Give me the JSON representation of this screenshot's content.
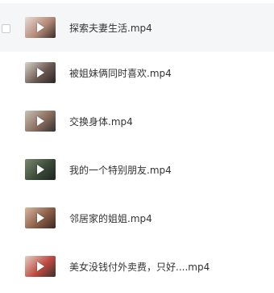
{
  "files": [
    {
      "name": "探索夫妻生活.mp4",
      "thumb_colors": [
        "#e8dcd6",
        "#b48a78",
        "#3a2c2a"
      ]
    },
    {
      "name": "被姐妹俩同时喜欢.mp4",
      "thumb_colors": [
        "#d9d4cc",
        "#6d5a52",
        "#2a2424"
      ]
    },
    {
      "name": "交换身体.mp4",
      "thumb_colors": [
        "#c9c2b8",
        "#8a6e5e",
        "#33302e"
      ]
    },
    {
      "name": "我的一个特别朋友.mp4",
      "thumb_colors": [
        "#7a8a70",
        "#3a4a38",
        "#1e2420"
      ]
    },
    {
      "name": "邻居家的姐姐.mp4",
      "thumb_colors": [
        "#d8b8a0",
        "#8c5e48",
        "#3a2820"
      ]
    },
    {
      "name": "美女没钱付外卖费，只好....mp4",
      "thumb_colors": [
        "#e2d0c6",
        "#c04a40",
        "#38302c"
      ]
    }
  ]
}
